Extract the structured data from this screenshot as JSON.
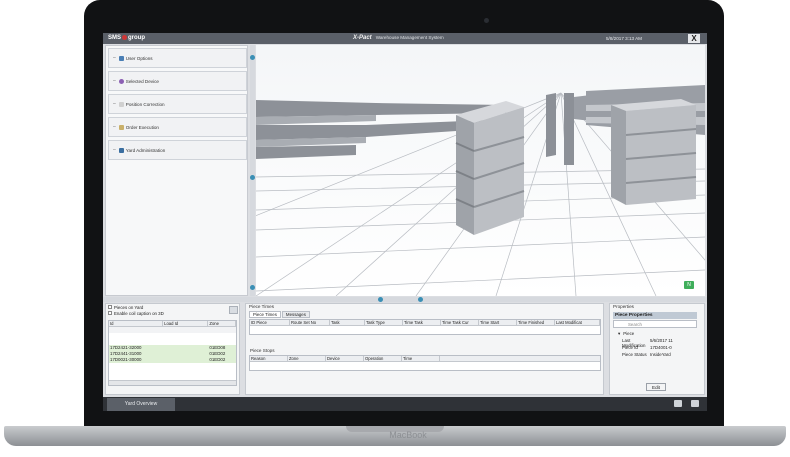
{
  "device": {
    "brand_label": "MacBook"
  },
  "titlebar": {
    "logo_text_left": "SMS",
    "logo_text_right": "group",
    "app_name": "X-Pact",
    "app_subtitle": "Warehouse Management System",
    "datetime": "5/8/2017 3:13 AM",
    "close_label": "X"
  },
  "left_panel": {
    "sections": [
      {
        "label": "User Options",
        "icon": "user-icon",
        "color": "#4a7fb5"
      },
      {
        "label": "Selected Device",
        "icon": "device-icon",
        "color": "#8b5fb3"
      },
      {
        "label": "Position Correction",
        "icon": "position-icon",
        "color": "#d0d0d0"
      },
      {
        "label": "Order Execution",
        "icon": "order-icon",
        "color": "#c9b06a"
      },
      {
        "label": "Yard Administration",
        "icon": "yard-icon",
        "color": "#3a6ea0"
      }
    ]
  },
  "viewport": {
    "compass_label": "N"
  },
  "yard_panel": {
    "checkbox_pieces": "Pieces on Yard",
    "checkbox_caption": "Enable coil caption on 3D",
    "columns": [
      "Id",
      "Load Id",
      "Zone"
    ],
    "rows": [
      [
        "17D2421-32000",
        "",
        "01ED08"
      ],
      [
        "17D2441-31000",
        "",
        "01ED02"
      ],
      [
        "17D0021-30000",
        "",
        "01ED02"
      ]
    ]
  },
  "piece_times": {
    "title": "Piece Times",
    "tabs": [
      "Piece Times",
      "Messages"
    ],
    "columns": [
      "ID Piece",
      "Route Set No",
      "Task",
      "Task Type",
      "Time Task",
      "Time Task Cur",
      "Time Start",
      "Time Finished",
      "Last Modificat"
    ],
    "stops_title": "Piece Stops",
    "stops_columns": [
      "Reason",
      "Zone",
      "Device",
      "Operation",
      "Time"
    ]
  },
  "properties": {
    "panel_title": "Properties",
    "header": "Piece Properties",
    "search_placeholder": "Search",
    "group": "Piece",
    "items": [
      {
        "key": "Last Modification",
        "value": "5/6/2017 11"
      },
      {
        "key": "Piece Id",
        "value": "17D4001-0"
      },
      {
        "key": "Piece Status",
        "value": "InsideYard"
      }
    ],
    "edit_label": "Edit"
  },
  "statusbar": {
    "yard_tab_label": "Yard Overview"
  },
  "colors": {
    "accent": "#3b8fb5",
    "titlebar": "#5a5f68",
    "logo_dot": "#d03535"
  }
}
